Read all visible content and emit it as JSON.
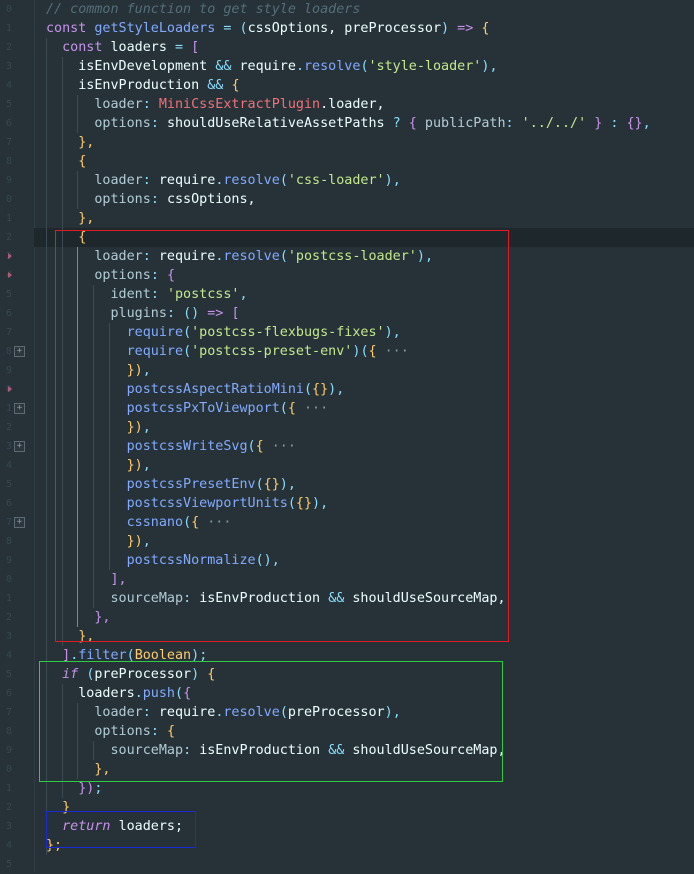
{
  "lines": [
    [
      [
        "// common function to get style loaders",
        "cm"
      ]
    ],
    [
      [
        "const ",
        "kw"
      ],
      [
        "getStyleLoaders",
        "fn"
      ],
      [
        " = ",
        "op"
      ],
      [
        "(",
        "br3"
      ],
      [
        "cssOptions, preProcessor",
        "pl"
      ],
      [
        ")",
        "br3"
      ],
      [
        " => ",
        "kw"
      ],
      [
        "{",
        "br"
      ]
    ],
    [
      [
        "  const ",
        "kw"
      ],
      [
        "loaders",
        "pl"
      ],
      [
        " = ",
        "op"
      ],
      [
        "[",
        "br2"
      ]
    ],
    [
      [
        "    isEnvDevelopment ",
        "pl"
      ],
      [
        "&& ",
        "op"
      ],
      [
        "require",
        "pl"
      ],
      [
        ".",
        "op"
      ],
      [
        "resolve",
        "fn"
      ],
      [
        "(",
        "br3"
      ],
      [
        "'style-loader'",
        "str"
      ],
      [
        ")",
        "br3"
      ],
      [
        ",",
        "op"
      ]
    ],
    [
      [
        "    isEnvProduction ",
        "pl"
      ],
      [
        "&& ",
        "op"
      ],
      [
        "{",
        "br"
      ]
    ],
    [
      [
        "      loader",
        "prop"
      ],
      [
        ": ",
        "op"
      ],
      [
        "MiniCssExtractPlugin",
        "var"
      ],
      [
        ".loader,",
        "pl"
      ]
    ],
    [
      [
        "      options",
        "prop"
      ],
      [
        ": ",
        "op"
      ],
      [
        "shouldUseRelativeAssetPaths ",
        "pl"
      ],
      [
        "? ",
        "op"
      ],
      [
        "{ ",
        "br2"
      ],
      [
        "publicPath",
        "prop"
      ],
      [
        ": ",
        "op"
      ],
      [
        "'../../'",
        "str"
      ],
      [
        " } ",
        "br2"
      ],
      [
        ": ",
        "op"
      ],
      [
        "{}",
        "br2"
      ],
      [
        ",",
        "op"
      ]
    ],
    [
      [
        "    },",
        "br"
      ]
    ],
    [
      [
        "    {",
        "br"
      ]
    ],
    [
      [
        "      loader",
        "prop"
      ],
      [
        ": ",
        "op"
      ],
      [
        "require",
        "pl"
      ],
      [
        ".",
        "op"
      ],
      [
        "resolve",
        "fn"
      ],
      [
        "(",
        "br3"
      ],
      [
        "'css-loader'",
        "str"
      ],
      [
        ")",
        "br3"
      ],
      [
        ",",
        "op"
      ]
    ],
    [
      [
        "      options",
        "prop"
      ],
      [
        ": ",
        "op"
      ],
      [
        "cssOptions,",
        "pl"
      ]
    ],
    [
      [
        "    },",
        "br"
      ]
    ],
    [
      [
        "    {",
        "br"
      ]
    ],
    [
      [
        "      loader",
        "prop"
      ],
      [
        ": ",
        "op"
      ],
      [
        "require",
        "pl"
      ],
      [
        ".",
        "op"
      ],
      [
        "resolve",
        "fn"
      ],
      [
        "(",
        "br3"
      ],
      [
        "'postcss-loader'",
        "str"
      ],
      [
        ")",
        "br3"
      ],
      [
        ",",
        "op"
      ]
    ],
    [
      [
        "      options",
        "prop"
      ],
      [
        ": ",
        "op"
      ],
      [
        "{",
        "br2"
      ]
    ],
    [
      [
        "        ident",
        "prop"
      ],
      [
        ": ",
        "op"
      ],
      [
        "'postcss'",
        "str"
      ],
      [
        ",",
        "op"
      ]
    ],
    [
      [
        "        plugins",
        "prop"
      ],
      [
        ": ",
        "op"
      ],
      [
        "() ",
        "br3"
      ],
      [
        "=> ",
        "kw"
      ],
      [
        "[",
        "br2"
      ]
    ],
    [
      [
        "          require",
        "fn"
      ],
      [
        "(",
        "br3"
      ],
      [
        "'postcss-flexbugs-fixes'",
        "str"
      ],
      [
        ")",
        "br3"
      ],
      [
        ",",
        "op"
      ]
    ],
    [
      [
        "          require",
        "fn"
      ],
      [
        "(",
        "br3"
      ],
      [
        "'postcss-preset-env'",
        "str"
      ],
      [
        ")",
        "br3"
      ],
      [
        "(",
        "br3"
      ],
      [
        "{",
        "br"
      ],
      [
        " ···",
        "ell"
      ]
    ],
    [
      [
        "          })",
        "br"
      ],
      [
        ",",
        "op"
      ]
    ],
    [
      [
        "          postcssAspectRatioMini",
        "fn"
      ],
      [
        "(",
        "br3"
      ],
      [
        "{}",
        "br"
      ],
      [
        ")",
        "br3"
      ],
      [
        ",",
        "op"
      ]
    ],
    [
      [
        "          postcssPxToViewport",
        "fn"
      ],
      [
        "(",
        "br3"
      ],
      [
        "{",
        "br"
      ],
      [
        " ···",
        "ell"
      ]
    ],
    [
      [
        "          })",
        "br"
      ],
      [
        ",",
        "op"
      ]
    ],
    [
      [
        "          postcssWriteSvg",
        "fn"
      ],
      [
        "(",
        "br3"
      ],
      [
        "{",
        "br"
      ],
      [
        " ···",
        "ell"
      ]
    ],
    [
      [
        "          })",
        "br"
      ],
      [
        ",",
        "op"
      ]
    ],
    [
      [
        "          postcssPresetEnv",
        "fn"
      ],
      [
        "(",
        "br3"
      ],
      [
        "{}",
        "br"
      ],
      [
        ")",
        "br3"
      ],
      [
        ",",
        "op"
      ]
    ],
    [
      [
        "          postcssViewportUnits",
        "fn"
      ],
      [
        "(",
        "br3"
      ],
      [
        "{}",
        "br"
      ],
      [
        ")",
        "br3"
      ],
      [
        ",",
        "op"
      ]
    ],
    [
      [
        "          cssnano",
        "fn"
      ],
      [
        "(",
        "br3"
      ],
      [
        "{",
        "br"
      ],
      [
        " ···",
        "ell"
      ]
    ],
    [
      [
        "          })",
        "br"
      ],
      [
        ",",
        "op"
      ]
    ],
    [
      [
        "          postcssNormalize",
        "fn"
      ],
      [
        "()",
        "br3"
      ],
      [
        ",",
        "op"
      ]
    ],
    [
      [
        "        ],",
        "br2"
      ]
    ],
    [
      [
        "        sourceMap",
        "prop"
      ],
      [
        ": ",
        "op"
      ],
      [
        "isEnvProduction ",
        "pl"
      ],
      [
        "&& ",
        "op"
      ],
      [
        "shouldUseSourceMap,",
        "pl"
      ]
    ],
    [
      [
        "      },",
        "br2"
      ]
    ],
    [
      [
        "    },",
        "br"
      ]
    ],
    [
      [
        "  ]",
        "br2"
      ],
      [
        ".",
        "op"
      ],
      [
        "filter",
        "fn"
      ],
      [
        "(",
        "br3"
      ],
      [
        "Boolean",
        "cls"
      ],
      [
        ")",
        "br3"
      ],
      [
        ";",
        "op"
      ]
    ],
    [
      [
        "  if ",
        "kwi"
      ],
      [
        "(",
        "br3"
      ],
      [
        "preProcessor",
        "pl"
      ],
      [
        ") ",
        "br3"
      ],
      [
        "{",
        "br"
      ]
    ],
    [
      [
        "    loaders",
        "pl"
      ],
      [
        ".",
        "op"
      ],
      [
        "push",
        "fn"
      ],
      [
        "(",
        "br3"
      ],
      [
        "{",
        "br2"
      ]
    ],
    [
      [
        "      loader",
        "prop"
      ],
      [
        ": ",
        "op"
      ],
      [
        "require",
        "pl"
      ],
      [
        ".",
        "op"
      ],
      [
        "resolve",
        "fn"
      ],
      [
        "(",
        "br3"
      ],
      [
        "preProcessor",
        "pl"
      ],
      [
        ")",
        "br3"
      ],
      [
        ",",
        "op"
      ]
    ],
    [
      [
        "      options",
        "prop"
      ],
      [
        ": ",
        "op"
      ],
      [
        "{",
        "br"
      ]
    ],
    [
      [
        "        sourceMap",
        "prop"
      ],
      [
        ": ",
        "op"
      ],
      [
        "isEnvProduction ",
        "pl"
      ],
      [
        "&& ",
        "op"
      ],
      [
        "shouldUseSourceMap,",
        "pl"
      ]
    ],
    [
      [
        "      },",
        "br"
      ]
    ],
    [
      [
        "    })",
        "br2"
      ],
      [
        ";",
        "op"
      ]
    ],
    [
      [
        "  }",
        "br"
      ]
    ],
    [
      [
        "  return ",
        "kwi"
      ],
      [
        "loaders;",
        "pl"
      ]
    ],
    [
      [
        "};",
        "br"
      ]
    ]
  ],
  "gutter_line_numbers": [
    "0",
    "1",
    "2",
    "3",
    "4",
    "5",
    "6",
    "7",
    "8",
    "9",
    "0",
    "1",
    "2",
    "3",
    "4",
    "5",
    "6",
    "7",
    "8",
    "9",
    "0",
    "1",
    "2",
    "3",
    "4",
    "5",
    "6",
    "7",
    "8",
    "9",
    "0",
    "1",
    "2",
    "3",
    "4",
    "5",
    "6",
    "7",
    "8",
    "9",
    "0",
    "1",
    "2",
    "3",
    "4",
    "5"
  ],
  "fold_markers": [
    "+",
    "+",
    "+",
    "+"
  ],
  "highlight_colors": {
    "red_box": "#e01b24",
    "green_box": "#2ecc40",
    "blue_box": "#1a2bd6"
  },
  "theme": {
    "background": "#263238",
    "gutter_text": "#37474f"
  }
}
